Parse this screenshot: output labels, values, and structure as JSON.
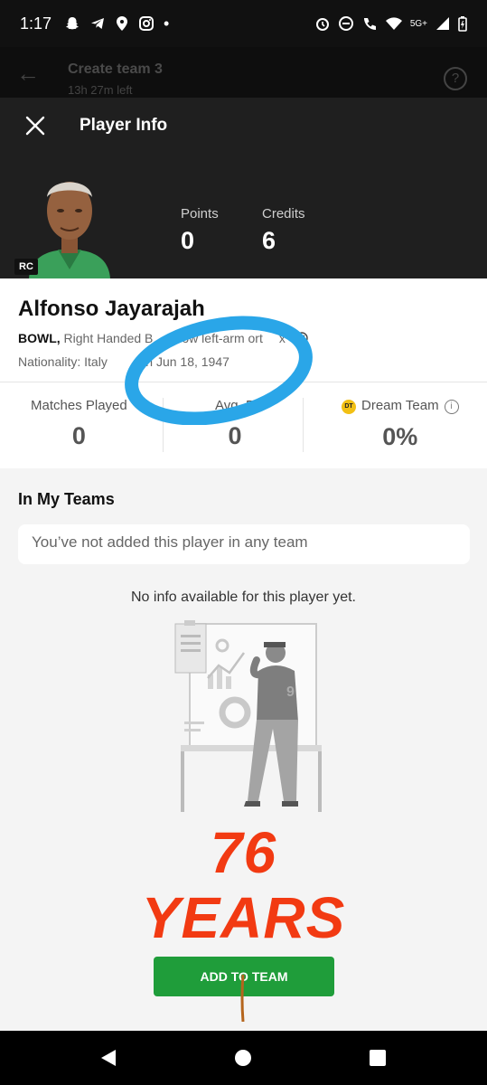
{
  "status_bar": {
    "time": "1:17",
    "network": "5G+",
    "left_icons": [
      "snapchat-icon",
      "telegram-icon",
      "location-icon",
      "instagram-icon",
      "dot-icon"
    ],
    "right_icons": [
      "alarm-icon",
      "dnd-icon",
      "call-icon",
      "wifi-icon",
      "signal-icon",
      "battery-icon"
    ]
  },
  "app_header": {
    "title": "Create team 3",
    "subtitle": "13h 27m left"
  },
  "sheet": {
    "title": "Player Info",
    "avatar_badge": "RC",
    "points_label": "Points",
    "points_value": "0",
    "credits_label": "Credits",
    "credits_value": "6"
  },
  "player": {
    "name": "Alfonso Jayarajah",
    "role": "BOWL,",
    "style": "Right Handed B",
    "style_rest": "ow left-arm ort",
    "style_tail": "x",
    "nationality": "Nationality: Italy",
    "born": "orn Jun 18, 1947"
  },
  "match_stats": {
    "matches_label": "Matches Played",
    "matches_value": "0",
    "avg_label": "Avg. P",
    "avg_value": "0",
    "dream_label": "Dream Team",
    "dream_badge": "DT",
    "dream_value": "0%"
  },
  "teams": {
    "title": "In My Teams",
    "empty_message": "You’ve not added this player in any team"
  },
  "no_info": "No info available for this player yet.",
  "overlay": {
    "number": "76",
    "word": "YEARS"
  },
  "add_button": "ADD TO TEAM",
  "colors": {
    "annotation": "#2aa6e8",
    "overlay_red": "#f23a12",
    "button_green": "#1f9d3a"
  }
}
